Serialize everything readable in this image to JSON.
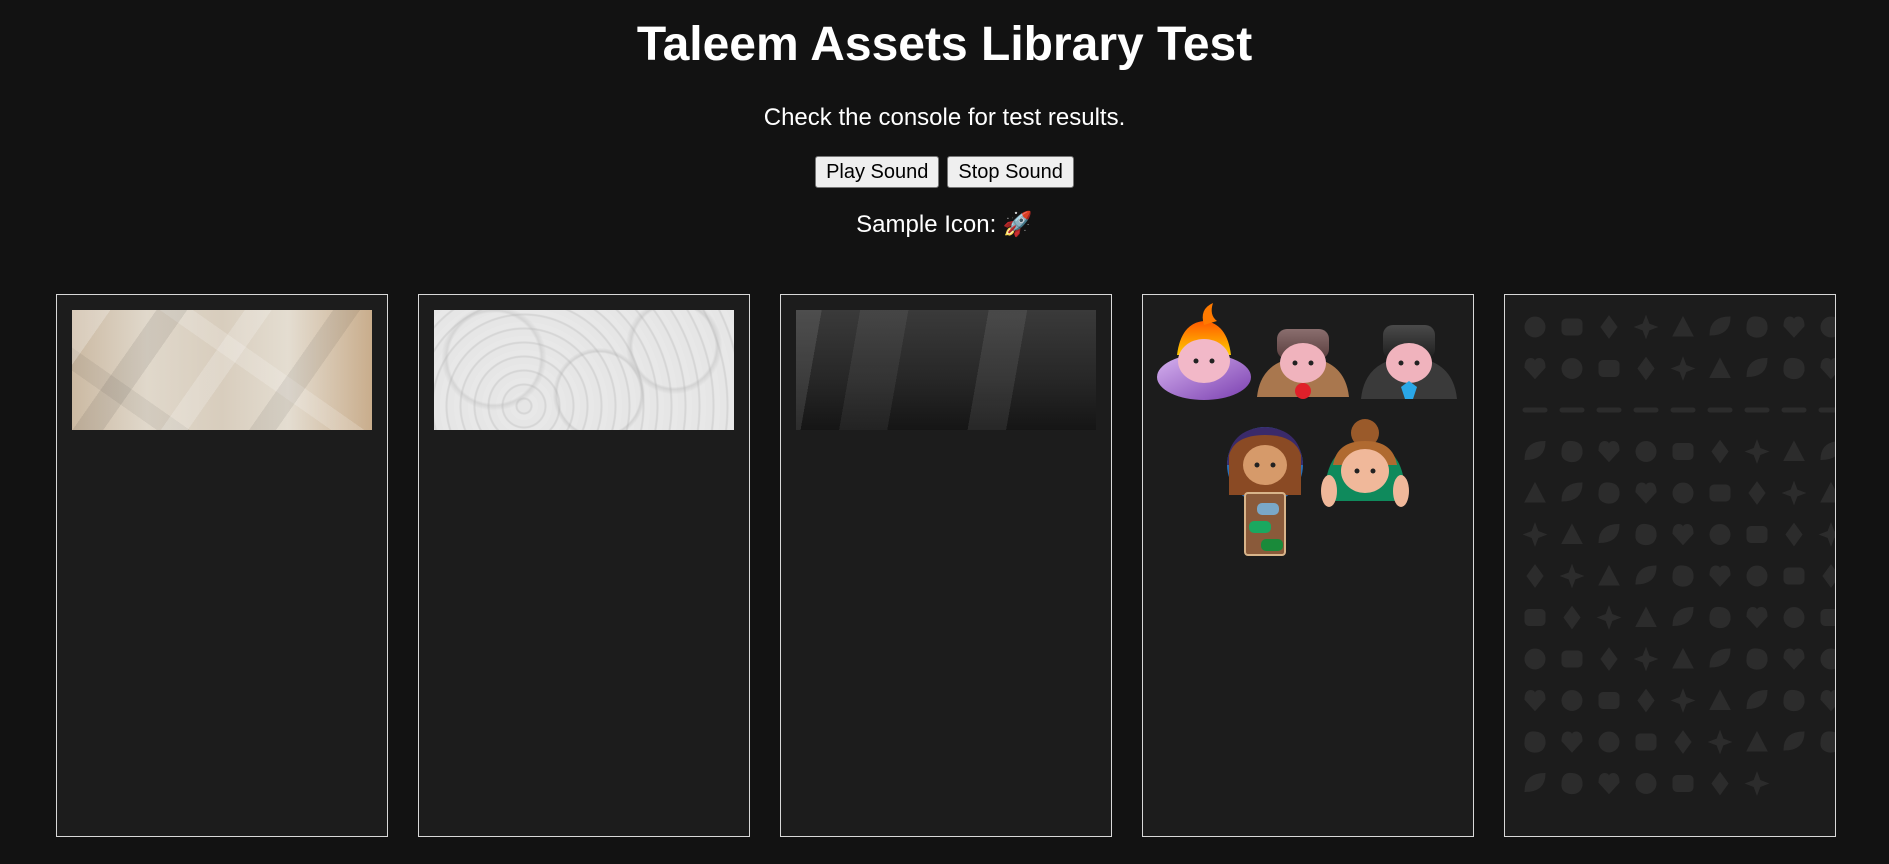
{
  "page": {
    "title": "Taleem Assets Library Test",
    "subtitle": "Check the console for test results.",
    "play_label": "Play Sound",
    "stop_label": "Stop Sound",
    "sample_icon_label": "Sample Icon:",
    "sample_icon_glyph": "🚀"
  },
  "panels": [
    {
      "kind": "texture",
      "texture": "crumpled-paper"
    },
    {
      "kind": "texture",
      "texture": "white-plaster"
    },
    {
      "kind": "texture",
      "texture": "dark-chalkboard"
    },
    {
      "kind": "avatars",
      "items": [
        "avatar-wizard",
        "avatar-man-red-tie",
        "avatar-man-blue-tie",
        "avatar-girl-with-book",
        "avatar-girl-bun"
      ]
    },
    {
      "kind": "pattern",
      "texture": "doodle-icon-pattern"
    }
  ],
  "colors": {
    "background": "#121212",
    "panel_background": "#1c1c1c",
    "panel_border": "#d8d8d8",
    "text": "#ffffff"
  }
}
